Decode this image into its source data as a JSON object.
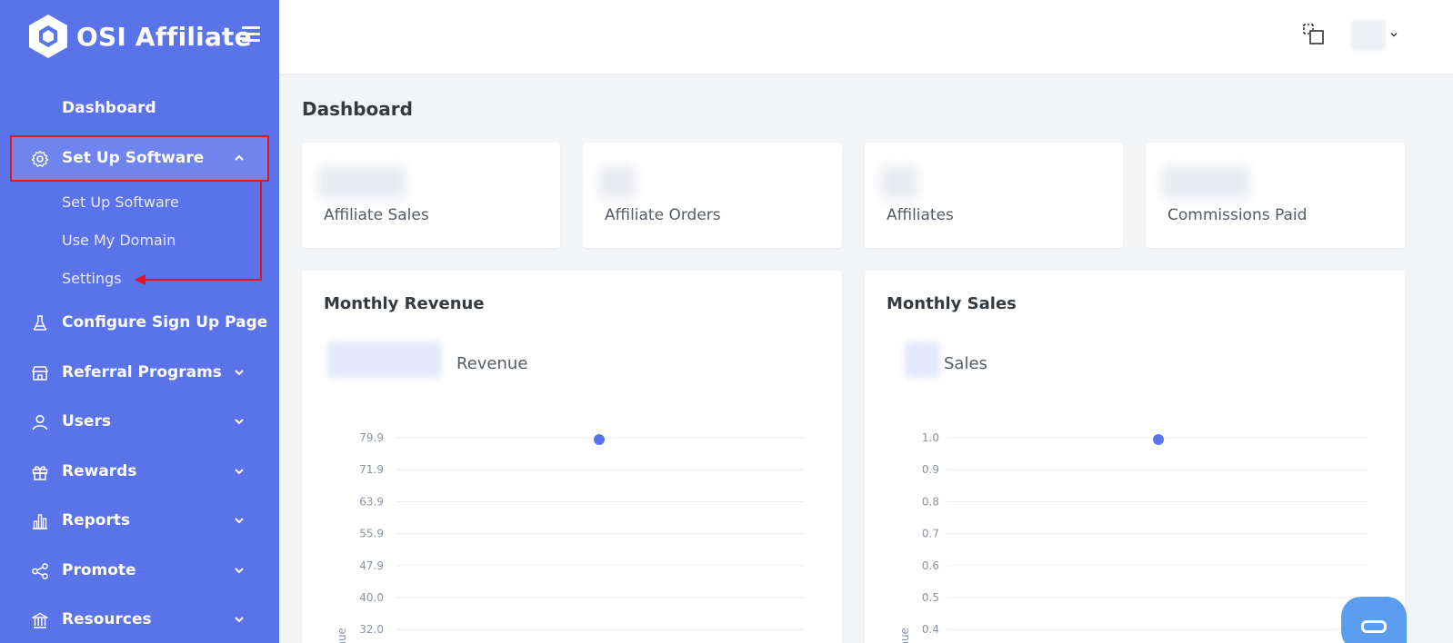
{
  "app": {
    "name": "OSI Affiliate"
  },
  "sidebar": {
    "dashboard": "Dashboard",
    "setup": {
      "label": "Set Up Software",
      "children": [
        "Set Up Software",
        "Use My Domain",
        "Settings"
      ]
    },
    "items": [
      {
        "label": "Configure Sign Up Page",
        "icon": "flask-icon",
        "has_chevron": false
      },
      {
        "label": "Referral Programs",
        "icon": "store-icon",
        "has_chevron": true
      },
      {
        "label": "Users",
        "icon": "user-icon",
        "has_chevron": true
      },
      {
        "label": "Rewards",
        "icon": "gift-icon",
        "has_chevron": true
      },
      {
        "label": "Reports",
        "icon": "bar-chart-icon",
        "has_chevron": true
      },
      {
        "label": "Promote",
        "icon": "share-icon",
        "has_chevron": true
      },
      {
        "label": "Resources",
        "icon": "bank-icon",
        "has_chevron": true
      }
    ]
  },
  "main": {
    "title": "Dashboard",
    "stats": [
      {
        "label": "Affiliate Sales"
      },
      {
        "label": "Affiliate Orders"
      },
      {
        "label": "Affiliates"
      },
      {
        "label": "Commissions Paid"
      }
    ]
  },
  "colors": {
    "sidebar": "#5b73e8",
    "accent": "#5b73e8",
    "annotation": "#e8121b"
  },
  "chart_data": [
    {
      "type": "line",
      "title": "Monthly Revenue",
      "legend": [
        "Revenue"
      ],
      "ylabel": "Revenue",
      "yticks": [
        "79.9",
        "71.9",
        "63.9",
        "55.9",
        "47.9",
        "40.0",
        "32.0"
      ],
      "series": [
        {
          "name": "Revenue",
          "values": [
            79.9
          ]
        }
      ]
    },
    {
      "type": "line",
      "title": "Monthly Sales",
      "legend": [
        "Sales"
      ],
      "ylabel": "Revenue",
      "yticks": [
        "1.0",
        "0.9",
        "0.8",
        "0.7",
        "0.6",
        "0.5",
        "0.4"
      ],
      "series": [
        {
          "name": "Sales",
          "values": [
            1.0
          ]
        }
      ]
    }
  ]
}
